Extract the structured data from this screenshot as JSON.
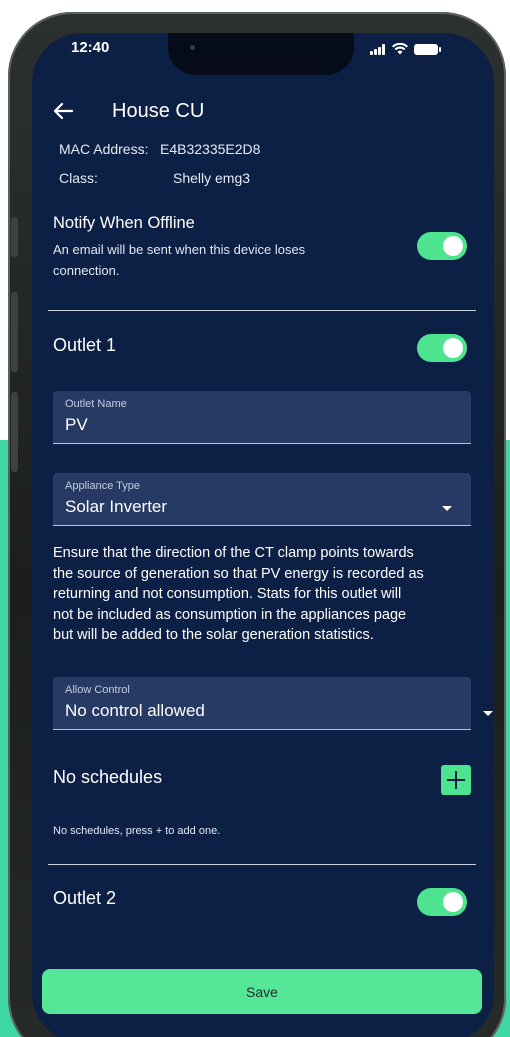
{
  "status_bar": {
    "time": "12:40"
  },
  "header": {
    "title": "House CU",
    "back_icon": "arrow-left-icon"
  },
  "device_info": {
    "mac_label": "MAC Address:",
    "mac_value": "E4B32335E2D8",
    "class_label": "Class:",
    "class_value": "Shelly emg3"
  },
  "notify": {
    "title": "Notify When Offline",
    "description_line1": "An email will be sent when this device loses",
    "description_line2": "connection.",
    "enabled": true
  },
  "outlet1": {
    "title": "Outlet 1",
    "enabled": true,
    "name_field": {
      "label": "Outlet Name",
      "value": "PV"
    },
    "appliance_field": {
      "label": "Appliance Type",
      "value": "Solar Inverter"
    },
    "description": [
      "Ensure that the direction of the CT clamp points towards",
      "the source of generation so that PV energy is recorded as",
      "returning and not consumption. Stats for this outlet will",
      "not be included as consumption in the appliances page",
      "but will be added to the solar generation statistics."
    ],
    "control_field": {
      "label": "Allow Control",
      "value": "No control allowed"
    },
    "schedules": {
      "title": "No schedules",
      "hint": "No schedules, press + to add one."
    }
  },
  "outlet2": {
    "title": "Outlet 2",
    "enabled": true
  },
  "save_button": {
    "label": "Save"
  },
  "colors": {
    "background": "#0c1f45",
    "accent": "#4ee38f",
    "field_background": "#273a63",
    "save_button": "#55e698",
    "page_backdrop": "#3fd6a6"
  }
}
